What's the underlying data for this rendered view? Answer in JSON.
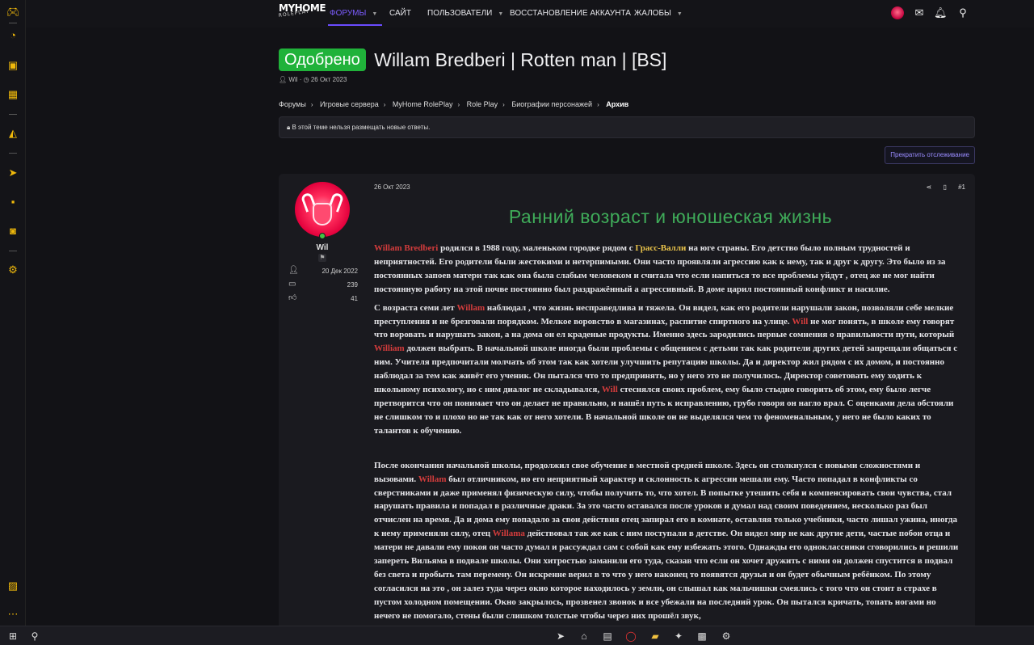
{
  "nav": {
    "logo_line1": "MYHOME",
    "logo_line2": "ROLEPLAY",
    "items": [
      {
        "label": "ФОРУМЫ"
      },
      {
        "label": "САЙТ"
      },
      {
        "label": "ПОЛЬЗОВАТЕЛИ"
      },
      {
        "label": "ВОССТАНОВЛЕНИЕ АККАУНТА"
      },
      {
        "label": "ЖАЛОБЫ"
      }
    ]
  },
  "thread": {
    "badge": "Одобрено",
    "title": "Willam Bredberi | Rotten man | [BS]",
    "author": "Wil",
    "meta_sep": " · ",
    "date": "26 Окт 2023"
  },
  "breadcrumbs": [
    "Форумы",
    "Игровые сервера",
    "MyHome RolePlay",
    "Role Play",
    "Биографии персонажей",
    "Архив"
  ],
  "notice": "В этой теме нельзя размещать новые ответы.",
  "watch_button": "Прекратить отслеживание",
  "post": {
    "user": {
      "name": "Wil",
      "joined": "20 Дек 2022",
      "messages": "239",
      "reactions": "41"
    },
    "date": "26 Окт 2023",
    "number": "#1",
    "heading": "Ранний возраст и юношеская жизнь",
    "p1": [
      {
        "t": "Willam Bredberi",
        "c": "red"
      },
      {
        "t": " родился в 1988 году, маленьком городке рядом с "
      },
      {
        "t": "Грасс-Валли",
        "c": "gold"
      },
      {
        "t": " на юге страны. Его детство было полным трудностей и неприятностей. Его родители были жестокими и нетерпимыми. Они часто проявляли агрессию как к нему, так и друг к другу. Это было из за постоянных запоев матери так как она была слабым человеком и считала что если напиться то все проблемы уйдут , отец же не мог найти постоянную работу на этой почве постоянно был раздражённый а агрессивный. В доме царил постоянный конфликт и насилие."
      }
    ],
    "p2": [
      {
        "t": "С возраста семи лет "
      },
      {
        "t": "Willam",
        "c": "red"
      },
      {
        "t": " наблюдал , что жизнь несправедлива и тяжела. Он видел, как его родители нарушали закон, позволяли себе мелкие преступления и не брезговали порядком. Мелкое воровство в магазинах, распитие спиртного на улице. "
      },
      {
        "t": "Will",
        "c": "red"
      },
      {
        "t": " не мог понять, в школе ему говорят что воровать и нарушать закон, а на дома он ел краденые продукты. Именно здесь зародились первые сомнения о правильности пути, который "
      },
      {
        "t": "William",
        "c": "red"
      },
      {
        "t": " должен выбрать. В начальной школе иногда были проблемы с общением с детьми так как родители других детей запрещали общаться с ним. Учителя предпочитали молчать об этом так как хотели улучшить репутацию школы. Да и директор жил рядом с их домом, и постоянно наблюдал за тем как живёт его ученик. Он пытался что то предпринять, но у него это не получилось. Директор советовать ему ходить к школьному психологу, но с ним диалог не складывался, "
      },
      {
        "t": "Will",
        "c": "red"
      },
      {
        "t": " стеснялся своих проблем, ему было стыдно говорить об этом, ему было легче претворится что он понимает что он делает не правильно, и нашёл путь к исправлению, грубо говоря он нагло врал. С оценками дела обстояли не слишком то и плохо но не так как от него хотели. В начальной школе он не выделялся чем то феноменальным, у него не было каких то талантов к обучению."
      }
    ],
    "p3": [
      {
        "t": "После окончания начальной школы, продолжил свое обучение в местной средней школе. Здесь он столкнулся с новыми сложностями и вызовами. "
      },
      {
        "t": "Willam",
        "c": "red"
      },
      {
        "t": " был отличником, но его неприятный характер и склонность к агрессии мешали ему. Часто попадал в конфликты со сверстниками и даже применял физическую силу, чтобы получить то, что хотел. В попытке утешить себя и компенсировать свои чувства, стал нарушать правила и попадал в различные драки. За это часто оставался после уроков и думал над своим поведением, несколько раз был отчислен на время. Да и дома ему попадало за свои действия отец запирал его в комнате, оставляя только учебники, часто лишал ужина, иногда к нему применяли силу, отец "
      },
      {
        "t": "Willama",
        "c": "red"
      },
      {
        "t": " действовал так же как с ним поступали в детстве. Он видел мир не как другие дети, частые побои отца и матери не давали ему покоя он часто думал и рассуждал сам с собой как ему избежать этого. Однажды его одноклассники сговорились и решили запереть Вильяма в подвале школы. Они хитростью заманили его туда, сказав что если он хочет дружить с ними он должен спустится в подвал без света и пробыть там перемену. Он искренне верил в то что у него наконец то появятся друзья и он будет обычным ребёнком. По этому согласился на это , он залез туда через окно которое находилось у земли, он слышал как мальчишки смеялись с того что он стоит в страхе в пустом холодном помещении. Окно закрылось, прозвенел звонок и все убежали на последний урок. Он пытался кричать, топать ногами но нечего не помогало, стены были слишком толстые чтобы через них прошёл звук,"
      }
    ]
  }
}
